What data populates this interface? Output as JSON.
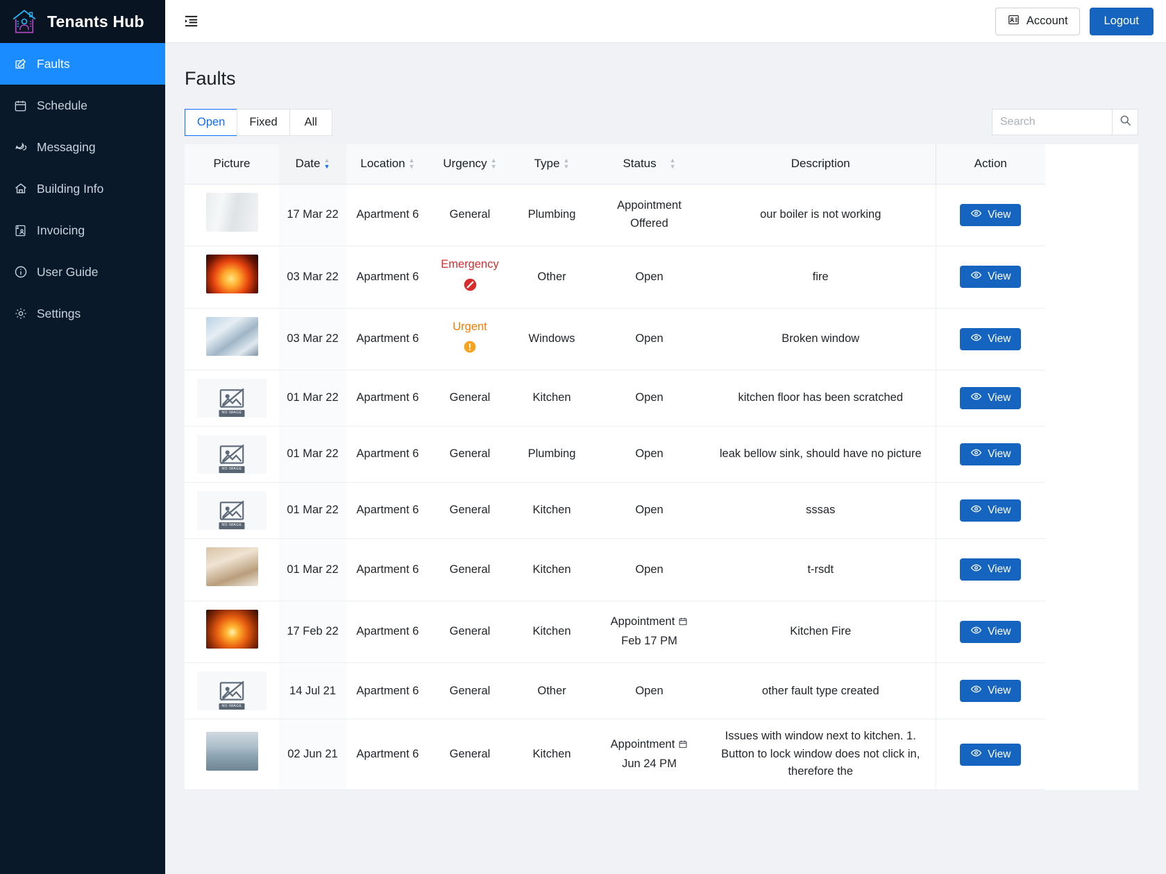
{
  "brand": {
    "title": "Tenants Hub",
    "logo_icon": "house-person-icon"
  },
  "sidebar": {
    "items": [
      {
        "label": "Faults",
        "icon": "edit-square-icon",
        "active": true
      },
      {
        "label": "Schedule",
        "icon": "calendar-icon",
        "active": false
      },
      {
        "label": "Messaging",
        "icon": "chat-bubble-icon",
        "active": false
      },
      {
        "label": "Building Info",
        "icon": "home-icon",
        "active": false
      },
      {
        "label": "Invoicing",
        "icon": "invoice-icon",
        "active": false
      },
      {
        "label": "User Guide",
        "icon": "info-circle-icon",
        "active": false
      },
      {
        "label": "Settings",
        "icon": "gear-icon",
        "active": false
      }
    ]
  },
  "topbar": {
    "collapse_icon": "sidebar-collapse-icon",
    "account_label": "Account",
    "account_icon": "id-card-icon",
    "logout_label": "Logout"
  },
  "page": {
    "title": "Faults"
  },
  "tabs": [
    {
      "label": "Open",
      "active": true
    },
    {
      "label": "Fixed",
      "active": false
    },
    {
      "label": "All",
      "active": false
    }
  ],
  "search": {
    "placeholder": "Search",
    "value": "",
    "icon": "search-icon"
  },
  "table": {
    "columns": [
      {
        "key": "picture",
        "label": "Picture",
        "sortable": false
      },
      {
        "key": "date",
        "label": "Date",
        "sortable": true,
        "sorted": "desc"
      },
      {
        "key": "location",
        "label": "Location",
        "sortable": true
      },
      {
        "key": "urgency",
        "label": "Urgency",
        "sortable": true
      },
      {
        "key": "type",
        "label": "Type",
        "sortable": true
      },
      {
        "key": "status",
        "label": "Status",
        "sortable": true
      },
      {
        "key": "description",
        "label": "Description",
        "sortable": false
      },
      {
        "key": "action",
        "label": "Action",
        "sortable": false
      }
    ],
    "action_label": "View",
    "action_icon": "eye-icon",
    "no_image_label": "NO IMAGE",
    "rows": [
      {
        "picture": "photo-boiler",
        "picture_kind": "image",
        "picture_style": "boiler",
        "date": "17 Mar 22",
        "location": "Apartment 6",
        "urgency": "General",
        "urgency_level": "general",
        "type": "Plumbing",
        "status": "Appointment Offered",
        "status_appointment": "",
        "description": "our boiler is not working"
      },
      {
        "picture": "photo-fire",
        "picture_kind": "image",
        "picture_style": "fire",
        "date": "03 Mar 22",
        "location": "Apartment 6",
        "urgency": "Emergency",
        "urgency_level": "emergency",
        "type": "Other",
        "status": "Open",
        "status_appointment": "",
        "description": "fire"
      },
      {
        "picture": "photo-broken-window",
        "picture_kind": "image",
        "picture_style": "window",
        "date": "03 Mar 22",
        "location": "Apartment 6",
        "urgency": "Urgent",
        "urgency_level": "urgent",
        "type": "Windows",
        "status": "Open",
        "status_appointment": "",
        "description": "Broken window"
      },
      {
        "picture": "no-image",
        "picture_kind": "placeholder",
        "date": "01 Mar 22",
        "location": "Apartment 6",
        "urgency": "General",
        "urgency_level": "general",
        "type": "Kitchen",
        "status": "Open",
        "status_appointment": "",
        "description": "kitchen floor has been scratched"
      },
      {
        "picture": "no-image",
        "picture_kind": "placeholder",
        "date": "01 Mar 22",
        "location": "Apartment 6",
        "urgency": "General",
        "urgency_level": "general",
        "type": "Plumbing",
        "status": "Open",
        "status_appointment": "",
        "description": "leak bellow sink, should have no picture"
      },
      {
        "picture": "no-image",
        "picture_kind": "placeholder",
        "date": "01 Mar 22",
        "location": "Apartment 6",
        "urgency": "General",
        "urgency_level": "general",
        "type": "Kitchen",
        "status": "Open",
        "status_appointment": "",
        "description": "sssas"
      },
      {
        "picture": "photo-sink",
        "picture_kind": "image",
        "picture_style": "sink",
        "date": "01 Mar 22",
        "location": "Apartment 6",
        "urgency": "General",
        "urgency_level": "general",
        "type": "Kitchen",
        "status": "Open",
        "status_appointment": "",
        "description": "t-rsdt"
      },
      {
        "picture": "photo-kitchen-fire",
        "picture_kind": "image",
        "picture_style": "kitchenfire",
        "date": "17 Feb 22",
        "location": "Apartment 6",
        "urgency": "General",
        "urgency_level": "general",
        "type": "Kitchen",
        "status": "Appointment",
        "status_appointment": "Feb 17 PM",
        "description": "Kitchen Fire"
      },
      {
        "picture": "no-image",
        "picture_kind": "placeholder",
        "date": "14 Jul 21",
        "location": "Apartment 6",
        "urgency": "General",
        "urgency_level": "general",
        "type": "Other",
        "status": "Open",
        "status_appointment": "",
        "description": "other fault type created"
      },
      {
        "picture": "photo-window-marked",
        "picture_kind": "image",
        "picture_style": "windowmark",
        "date": "02 Jun 21",
        "location": "Apartment 6",
        "urgency": "General",
        "urgency_level": "general",
        "type": "Kitchen",
        "status": "Appointment",
        "status_appointment": "Jun 24 PM",
        "description": "Issues with window next to kitchen. 1. Button to lock window does not click in, therefore the"
      }
    ]
  },
  "colors": {
    "sidebar_bg": "#0a1929",
    "sidebar_active": "#1a8cff",
    "primary": "#1565c0",
    "link": "#0d6efd",
    "emergency": "#d32f2f",
    "urgent": "#f57c00",
    "page_bg": "#f0f2f5"
  }
}
